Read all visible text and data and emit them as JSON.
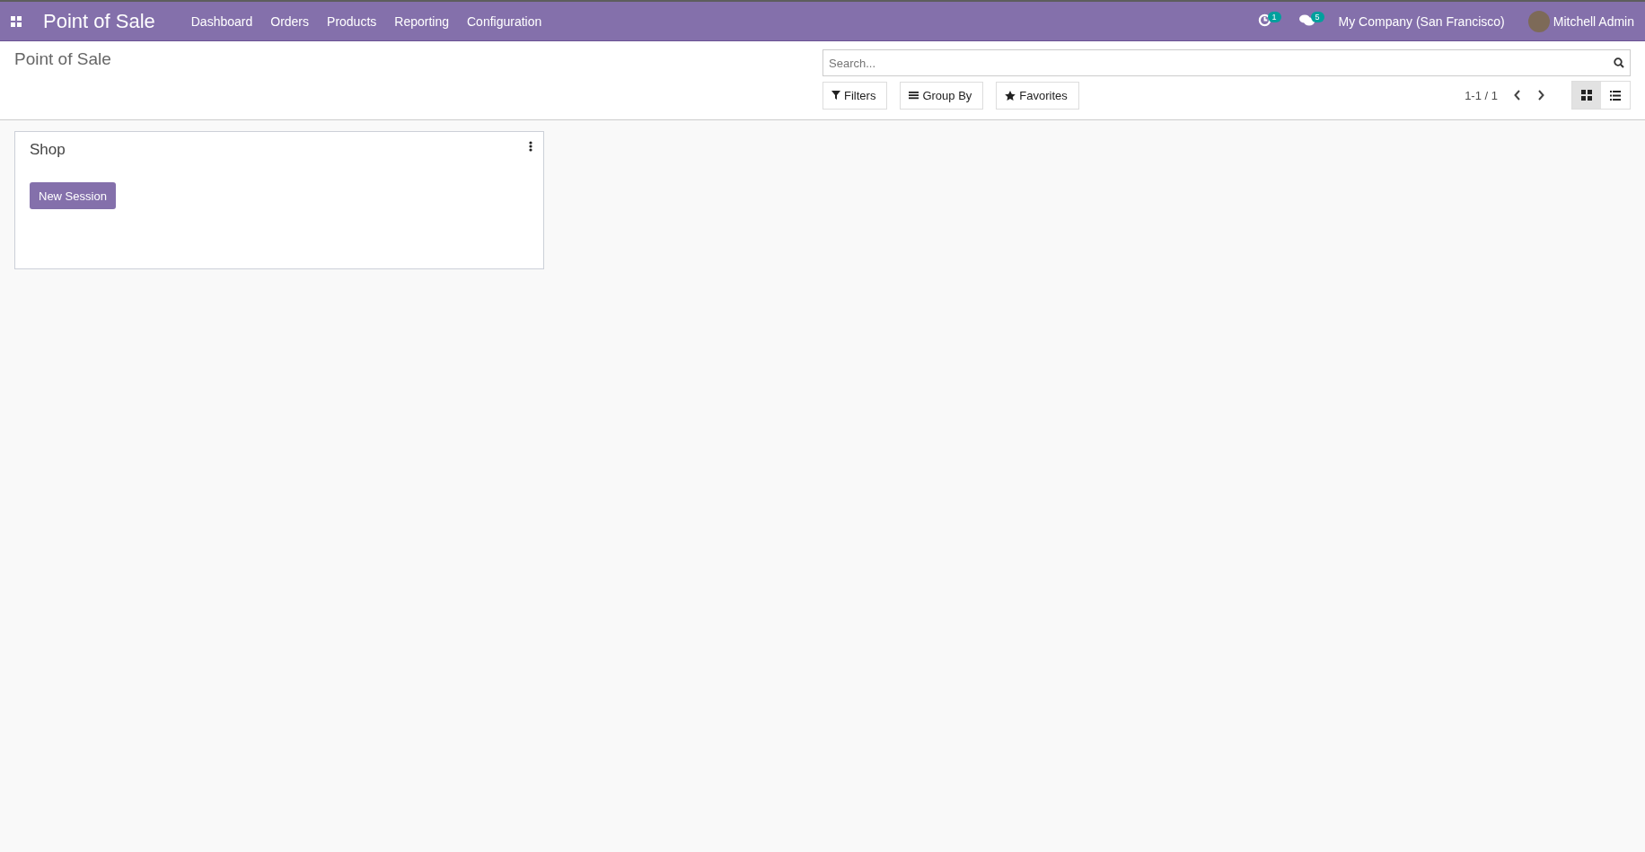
{
  "navbar": {
    "app_name": "Point of Sale",
    "menu": [
      "Dashboard",
      "Orders",
      "Products",
      "Reporting",
      "Configuration"
    ],
    "activity_count": "1",
    "message_count": "5",
    "company": "My Company (San Francisco)",
    "user": "Mitchell Admin"
  },
  "control_panel": {
    "title": "Point of Sale",
    "search": {
      "placeholder": "Search..."
    },
    "buttons": [
      {
        "kind": "filter",
        "label": "Filters"
      },
      {
        "kind": "group",
        "label": "Group By"
      },
      {
        "kind": "star",
        "label": "Favorites"
      }
    ],
    "pager": "1-1 / 1",
    "views": [
      {
        "kind": "kanban",
        "selected": true
      },
      {
        "kind": "list",
        "selected": false
      }
    ]
  },
  "cards": [
    {
      "title": "Shop",
      "button": "New Session"
    }
  ]
}
